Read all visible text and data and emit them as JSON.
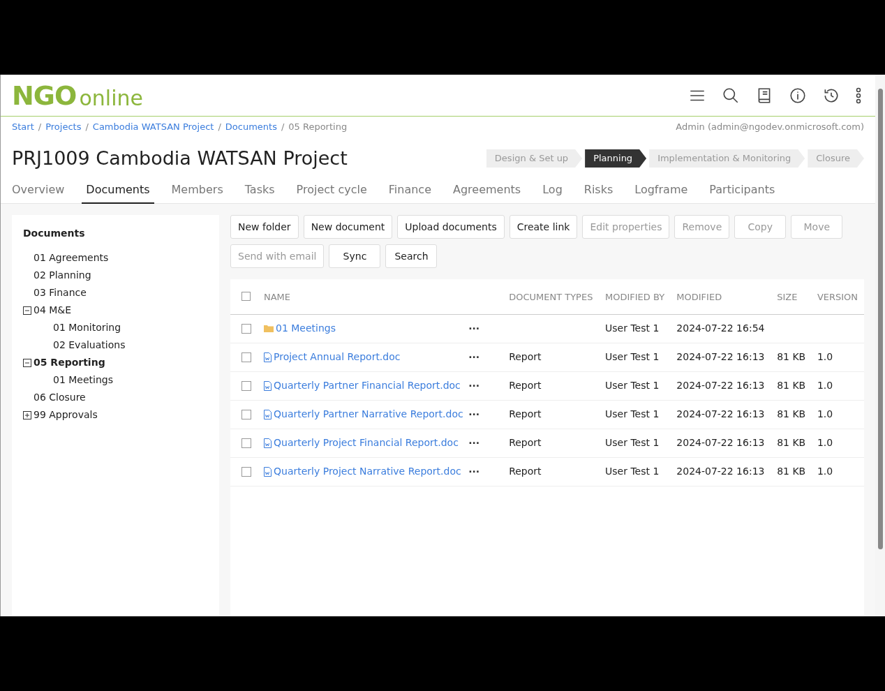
{
  "logo": {
    "part_1": "NGO",
    "part_2": "online"
  },
  "breadcrumb": {
    "items": [
      {
        "label": "Start",
        "kind": "link"
      },
      {
        "label": "Projects",
        "kind": "link"
      },
      {
        "label": "Cambodia WATSAN Project",
        "kind": "link"
      },
      {
        "label": "Documents",
        "kind": "link"
      },
      {
        "label": "05 Reporting",
        "kind": "current"
      }
    ],
    "separator": "/"
  },
  "user": "Admin (admin@ngodev.onmicrosoft.com)",
  "title": "PRJ1009 Cambodia WATSAN Project",
  "phases": [
    {
      "label": "Design & Set up",
      "selected": false
    },
    {
      "label": "Planning",
      "selected": true
    },
    {
      "label": "Implementation & Monitoring",
      "selected": false
    },
    {
      "label": "Closure",
      "selected": false
    }
  ],
  "tabs": [
    {
      "label": "Overview",
      "selected": false
    },
    {
      "label": "Documents",
      "selected": true
    },
    {
      "label": "Members",
      "selected": false
    },
    {
      "label": "Tasks",
      "selected": false
    },
    {
      "label": "Project cycle",
      "selected": false
    },
    {
      "label": "Finance",
      "selected": false
    },
    {
      "label": "Agreements",
      "selected": false
    },
    {
      "label": "Log",
      "selected": false
    },
    {
      "label": "Risks",
      "selected": false
    },
    {
      "label": "Logframe",
      "selected": false
    },
    {
      "label": "Participants",
      "selected": false
    }
  ],
  "sidebar": {
    "title": "Documents",
    "tree": [
      {
        "label": "01 Agreements",
        "selected": false
      },
      {
        "label": "02 Planning",
        "selected": false
      },
      {
        "label": "03 Finance",
        "selected": false
      },
      {
        "label": "04 M&E",
        "selected": false,
        "expanded": true,
        "children": [
          {
            "label": "01 Monitoring",
            "selected": false
          },
          {
            "label": "02 Evaluations",
            "selected": false
          }
        ]
      },
      {
        "label": "05 Reporting",
        "selected": true,
        "expanded": true,
        "children": [
          {
            "label": "01 Meetings",
            "selected": false
          }
        ]
      },
      {
        "label": "06 Closure",
        "selected": false
      },
      {
        "label": "99 Approvals",
        "selected": false,
        "expanded": false
      }
    ]
  },
  "toolbar": [
    [
      {
        "label": "New folder",
        "disabled": false
      },
      {
        "label": "New document",
        "disabled": false
      },
      {
        "label": "Upload documents",
        "disabled": false
      },
      {
        "label": "Create link",
        "disabled": false
      },
      {
        "label": "Edit properties",
        "disabled": true
      },
      {
        "label": "Remove",
        "disabled": true
      },
      {
        "label": "Copy",
        "disabled": true
      },
      {
        "label": "Move",
        "disabled": true
      }
    ],
    [
      {
        "label": "Send with email",
        "disabled": true
      },
      {
        "label": "Sync",
        "disabled": false
      },
      {
        "label": "Search",
        "disabled": false
      }
    ]
  ],
  "table": {
    "select_all_checked": false,
    "columns": [
      "NAME",
      "DOCUMENT TYPES",
      "MODIFIED BY",
      "MODIFIED",
      "SIZE",
      "VERSION"
    ],
    "more": "···",
    "rows": [
      {
        "kind": "folder",
        "checked": false,
        "name": "01 Meetings",
        "type": "",
        "modified_by": "User Test 1",
        "modified": "2024-07-22 16:54",
        "size": "",
        "version": ""
      },
      {
        "kind": "doc",
        "checked": false,
        "name": "Project Annual Report.doc",
        "type": "Report",
        "modified_by": "User Test 1",
        "modified": "2024-07-22 16:13",
        "size": "81 KB",
        "version": "1.0"
      },
      {
        "kind": "doc",
        "checked": false,
        "name": "Quarterly Partner Financial Report.doc",
        "type": "Report",
        "modified_by": "User Test 1",
        "modified": "2024-07-22 16:13",
        "size": "81 KB",
        "version": "1.0"
      },
      {
        "kind": "doc",
        "checked": false,
        "name": "Quarterly Partner Narrative Report.doc",
        "type": "Report",
        "modified_by": "User Test 1",
        "modified": "2024-07-22 16:13",
        "size": "81 KB",
        "version": "1.0"
      },
      {
        "kind": "doc",
        "checked": false,
        "name": "Quarterly Project Financial Report.doc",
        "type": "Report",
        "modified_by": "User Test 1",
        "modified": "2024-07-22 16:13",
        "size": "81 KB",
        "version": "1.0"
      },
      {
        "kind": "doc",
        "checked": false,
        "name": "Quarterly Project Narrative Report.doc",
        "type": "Report",
        "modified_by": "User Test 1",
        "modified": "2024-07-22 16:13",
        "size": "81 KB",
        "version": "1.0"
      }
    ]
  }
}
